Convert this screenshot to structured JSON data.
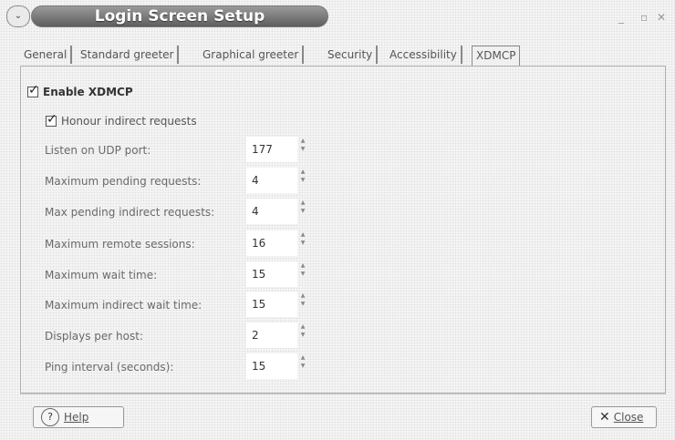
{
  "window": {
    "title": "Login Screen Setup",
    "menu_glyph": "⌄",
    "minimize_glyph": "_",
    "maximize_glyph": "▫",
    "close_glyph": "✕"
  },
  "tabs": [
    {
      "label": "General"
    },
    {
      "label": "Standard greeter"
    },
    {
      "label": "Graphical greeter"
    },
    {
      "label": "Security"
    },
    {
      "label": "Accessibility"
    },
    {
      "label": "XDMCP",
      "active": true
    }
  ],
  "xdmcp": {
    "enable_label": "Enable XDMCP",
    "enable_checked": true,
    "honour_label": "Honour indirect requests",
    "honour_checked": true,
    "fields": [
      {
        "label": "Listen on UDP port:",
        "value": "177"
      },
      {
        "label": "Maximum pending requests:",
        "value": "4"
      },
      {
        "label": "Max pending indirect requests:",
        "value": "4"
      },
      {
        "label": "Maximum remote sessions:",
        "value": "16"
      },
      {
        "label": "Maximum wait time:",
        "value": "15"
      },
      {
        "label": "Maximum indirect wait time:",
        "value": "15"
      },
      {
        "label": "Displays per host:",
        "value": "2"
      },
      {
        "label": "Ping interval (seconds):",
        "value": "15"
      }
    ],
    "spin_up": "▲",
    "spin_down": "▼"
  },
  "buttons": {
    "help_label": "Help",
    "help_icon": "?",
    "close_label": "Close",
    "close_icon": "✕"
  },
  "icons": [
    "menu-icon",
    "minimize-icon",
    "maximize-icon",
    "close-icon",
    "help-icon",
    "check-icon"
  ]
}
